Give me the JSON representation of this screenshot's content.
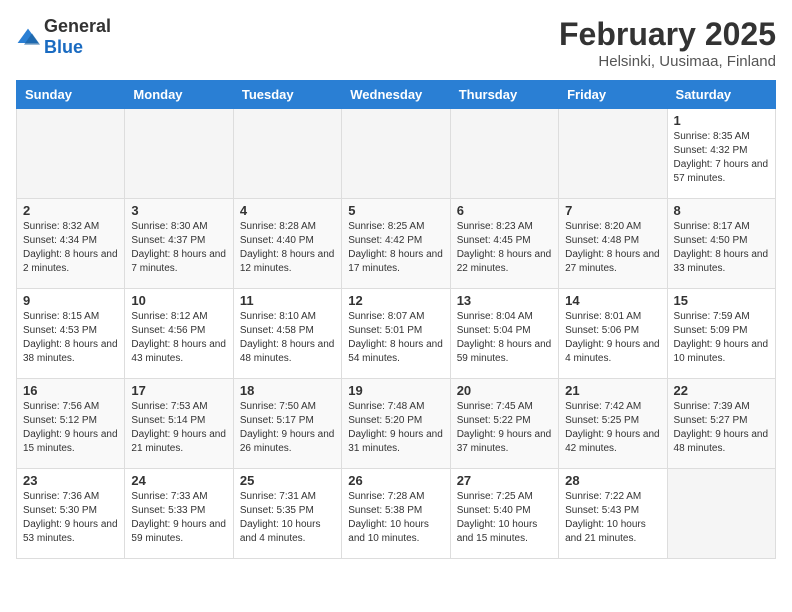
{
  "header": {
    "logo_general": "General",
    "logo_blue": "Blue",
    "month": "February 2025",
    "location": "Helsinki, Uusimaa, Finland"
  },
  "weekdays": [
    "Sunday",
    "Monday",
    "Tuesday",
    "Wednesday",
    "Thursday",
    "Friday",
    "Saturday"
  ],
  "weeks": [
    [
      {
        "day": "",
        "info": ""
      },
      {
        "day": "",
        "info": ""
      },
      {
        "day": "",
        "info": ""
      },
      {
        "day": "",
        "info": ""
      },
      {
        "day": "",
        "info": ""
      },
      {
        "day": "",
        "info": ""
      },
      {
        "day": "1",
        "info": "Sunrise: 8:35 AM\nSunset: 4:32 PM\nDaylight: 7 hours and 57 minutes."
      }
    ],
    [
      {
        "day": "2",
        "info": "Sunrise: 8:32 AM\nSunset: 4:34 PM\nDaylight: 8 hours and 2 minutes."
      },
      {
        "day": "3",
        "info": "Sunrise: 8:30 AM\nSunset: 4:37 PM\nDaylight: 8 hours and 7 minutes."
      },
      {
        "day": "4",
        "info": "Sunrise: 8:28 AM\nSunset: 4:40 PM\nDaylight: 8 hours and 12 minutes."
      },
      {
        "day": "5",
        "info": "Sunrise: 8:25 AM\nSunset: 4:42 PM\nDaylight: 8 hours and 17 minutes."
      },
      {
        "day": "6",
        "info": "Sunrise: 8:23 AM\nSunset: 4:45 PM\nDaylight: 8 hours and 22 minutes."
      },
      {
        "day": "7",
        "info": "Sunrise: 8:20 AM\nSunset: 4:48 PM\nDaylight: 8 hours and 27 minutes."
      },
      {
        "day": "8",
        "info": "Sunrise: 8:17 AM\nSunset: 4:50 PM\nDaylight: 8 hours and 33 minutes."
      }
    ],
    [
      {
        "day": "9",
        "info": "Sunrise: 8:15 AM\nSunset: 4:53 PM\nDaylight: 8 hours and 38 minutes."
      },
      {
        "day": "10",
        "info": "Sunrise: 8:12 AM\nSunset: 4:56 PM\nDaylight: 8 hours and 43 minutes."
      },
      {
        "day": "11",
        "info": "Sunrise: 8:10 AM\nSunset: 4:58 PM\nDaylight: 8 hours and 48 minutes."
      },
      {
        "day": "12",
        "info": "Sunrise: 8:07 AM\nSunset: 5:01 PM\nDaylight: 8 hours and 54 minutes."
      },
      {
        "day": "13",
        "info": "Sunrise: 8:04 AM\nSunset: 5:04 PM\nDaylight: 8 hours and 59 minutes."
      },
      {
        "day": "14",
        "info": "Sunrise: 8:01 AM\nSunset: 5:06 PM\nDaylight: 9 hours and 4 minutes."
      },
      {
        "day": "15",
        "info": "Sunrise: 7:59 AM\nSunset: 5:09 PM\nDaylight: 9 hours and 10 minutes."
      }
    ],
    [
      {
        "day": "16",
        "info": "Sunrise: 7:56 AM\nSunset: 5:12 PM\nDaylight: 9 hours and 15 minutes."
      },
      {
        "day": "17",
        "info": "Sunrise: 7:53 AM\nSunset: 5:14 PM\nDaylight: 9 hours and 21 minutes."
      },
      {
        "day": "18",
        "info": "Sunrise: 7:50 AM\nSunset: 5:17 PM\nDaylight: 9 hours and 26 minutes."
      },
      {
        "day": "19",
        "info": "Sunrise: 7:48 AM\nSunset: 5:20 PM\nDaylight: 9 hours and 31 minutes."
      },
      {
        "day": "20",
        "info": "Sunrise: 7:45 AM\nSunset: 5:22 PM\nDaylight: 9 hours and 37 minutes."
      },
      {
        "day": "21",
        "info": "Sunrise: 7:42 AM\nSunset: 5:25 PM\nDaylight: 9 hours and 42 minutes."
      },
      {
        "day": "22",
        "info": "Sunrise: 7:39 AM\nSunset: 5:27 PM\nDaylight: 9 hours and 48 minutes."
      }
    ],
    [
      {
        "day": "23",
        "info": "Sunrise: 7:36 AM\nSunset: 5:30 PM\nDaylight: 9 hours and 53 minutes."
      },
      {
        "day": "24",
        "info": "Sunrise: 7:33 AM\nSunset: 5:33 PM\nDaylight: 9 hours and 59 minutes."
      },
      {
        "day": "25",
        "info": "Sunrise: 7:31 AM\nSunset: 5:35 PM\nDaylight: 10 hours and 4 minutes."
      },
      {
        "day": "26",
        "info": "Sunrise: 7:28 AM\nSunset: 5:38 PM\nDaylight: 10 hours and 10 minutes."
      },
      {
        "day": "27",
        "info": "Sunrise: 7:25 AM\nSunset: 5:40 PM\nDaylight: 10 hours and 15 minutes."
      },
      {
        "day": "28",
        "info": "Sunrise: 7:22 AM\nSunset: 5:43 PM\nDaylight: 10 hours and 21 minutes."
      },
      {
        "day": "",
        "info": ""
      }
    ]
  ]
}
